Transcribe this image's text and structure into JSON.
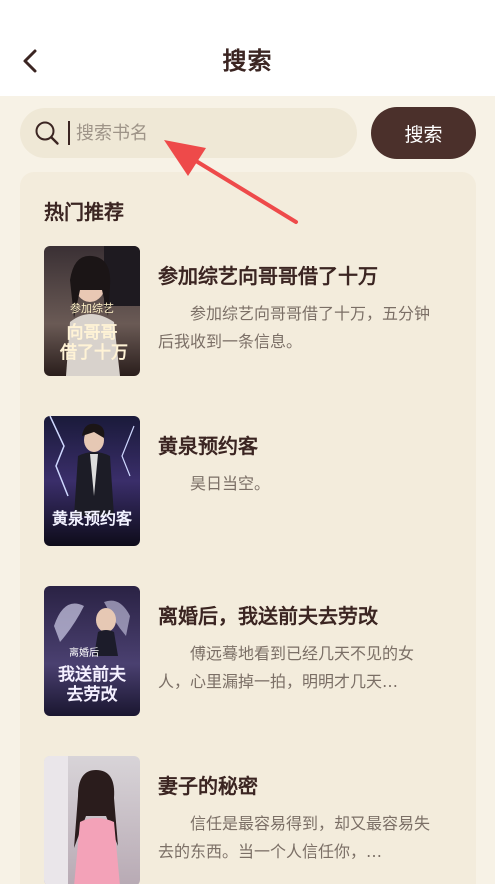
{
  "header": {
    "title": "搜索",
    "back_icon": "chevron-left-icon"
  },
  "search": {
    "placeholder": "搜索书名",
    "value": "",
    "button_label": "搜索",
    "icon": "search-icon"
  },
  "section": {
    "title": "热门推荐"
  },
  "books": [
    {
      "title": "参加综艺向哥哥借了十万",
      "desc": "参加综艺向哥哥借了十万，五分钟后我收到一条信息。",
      "cover_text": "向哥哥借了十万",
      "cover_small": "参加综艺"
    },
    {
      "title": "黄泉预约客",
      "desc": "昊日当空。",
      "cover_text": "黄泉预约客"
    },
    {
      "title": "离婚后，我送前夫去劳改",
      "desc": "傅远蓦地看到已经几天不见的女人，心里漏掉一拍，明明才几天…",
      "cover_text": "我送前夫去劳改",
      "cover_small": "离婚后"
    },
    {
      "title": "妻子的秘密",
      "desc": "信任是最容易得到，却又最容易失去的东西。当一个人信任你，…",
      "cover_text": ""
    }
  ],
  "colors": {
    "accent": "#4b302b",
    "background": "#f7f2e6",
    "card": "#f3ecdc",
    "annotation_arrow": "#ee4a4a"
  }
}
